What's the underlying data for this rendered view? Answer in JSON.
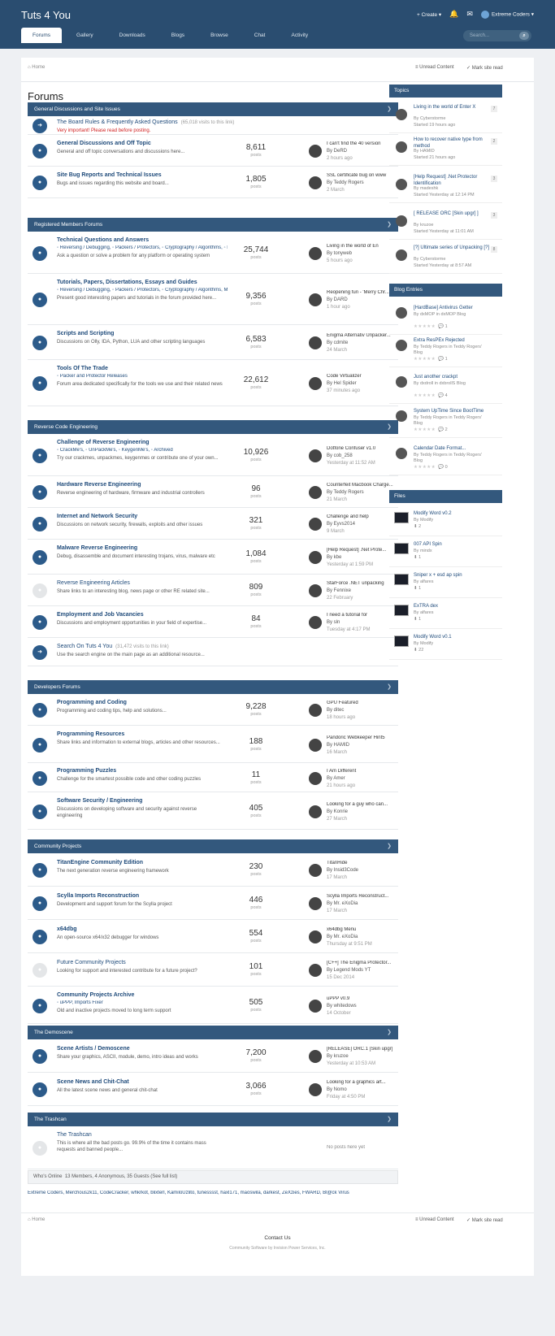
{
  "site": {
    "title": "Tuts 4 You",
    "create": "Create",
    "user": "Extreme Coders"
  },
  "nav": [
    "Forums",
    "Gallery",
    "Downloads",
    "Blogs",
    "Browse",
    "Chat",
    "Activity"
  ],
  "search": {
    "placeholder": "Search..."
  },
  "breadcrumb": "Home",
  "actions": {
    "unread": "Unread Content",
    "mark": "Mark site read"
  },
  "page_title": "Forums",
  "sections": [
    {
      "title": "General Discussions and Site Issues",
      "rows": [
        {
          "type": "redirect",
          "title": "The Board Rules & Frequently Asked Questions",
          "extra": "(65,018 visits to this link)",
          "desc": "Very important! Please read before posting."
        },
        {
          "title": "General Discussions and Off Topic",
          "desc": "General and off topic conversations and discussions here...",
          "count": "8,611",
          "last": "I can't find the 40 version",
          "by": "By DeRD",
          "when": "2 hours ago"
        },
        {
          "title": "Site Bug Reports and Technical Issues",
          "desc": "Bugs and issues regarding this website and board...",
          "count": "1,805",
          "last": "SSL certificate bug on www",
          "by": "By Teddy Rogers",
          "when": "2 March"
        }
      ]
    },
    {
      "title": "Registered Members Forums",
      "rows": [
        {
          "title": "Technical Questions and Answers",
          "subs": "◦ Reversing / Debugging,  ◦ Packers / Protectors,  ◦ Cryptography / Algorithms,  ◦ Miscellaneous Questions",
          "desc": "Ask a question or solve a problem for any platform or operating system",
          "count": "25,744",
          "last": "Living in the world of En",
          "by": "By tonyweb",
          "when": "5 hours ago"
        },
        {
          "title": "Tutorials, Papers, Dissertations, Essays and Guides",
          "subs": "◦ Reversing / Debugging,  ◦ Packers / Protectors,  ◦ Cryptography / Algorithms,  Miscellaneous Papers",
          "desc": "Present good interesting papers and tutorials in the forum provided here...",
          "count": "9,356",
          "last": "Reopening fun - 'Merry Chr...",
          "by": "By DARD",
          "when": "1 hour ago"
        },
        {
          "title": "Scripts and Scripting",
          "desc": "Discussions on Olly, IDA, Python, LUA and other scripting languages",
          "count": "6,583",
          "last": "Enigma Alternativ Unpacker...",
          "by": "By cdmite",
          "when": "24 March"
        },
        {
          "title": "Tools Of The Trade",
          "subs": "◦ Packer and Protector Releases",
          "desc": "Forum area dedicated specifically for the tools we use and their related news",
          "count": "22,612",
          "last": "Code Virtualizer",
          "by": "By Hel Spider",
          "when": "37 minutes ago"
        }
      ]
    },
    {
      "title": "Reverse Code Engineering",
      "rows": [
        {
          "title": "Challenge of Reverse Engineering",
          "subs": "◦ CrackMe's,  ◦ UnPackMe's,  ◦ KeygenMe's,  ◦ Archived",
          "desc": "Try our crackmes, unpackmes, keygenmes or contribute one of your own...",
          "count": "10,926",
          "last": "Dotfone Confuser v1.0",
          "by": "By cob_258",
          "when": "Yesterday at 11:52 AM"
        },
        {
          "title": "Hardware Reverse Engineering",
          "desc": "Reverse engineering of hardware, firmware and industrial controllers",
          "count": "96",
          "last": "Counterfeit Macbook Charge...",
          "by": "By Teddy Rogers",
          "when": "21 March"
        },
        {
          "title": "Internet and Network Security",
          "desc": "Discussions on network security, firewalls, exploits and other issues",
          "count": "321",
          "last": "Challenge and help",
          "by": "By Eyvs2014",
          "when": "9 March"
        },
        {
          "title": "Malware Reverse Engineering",
          "desc": "Debug, disassemble and document interesting trojans, virus, malware etc",
          "count": "1,084",
          "last": "[Help Request] .Net Prote...",
          "by": "By kbe",
          "when": "Yesterday at 1:59 PM"
        },
        {
          "type": "grey",
          "title": "Reverse Engineering Articles",
          "desc": "Share links to an interesting blog, news page or other RE related site...",
          "count": "809",
          "last": "StarForce .NET unpacking",
          "by": "By Fennixe",
          "when": "22 February"
        },
        {
          "title": "Employment and Job Vacancies",
          "desc": "Discussions and employment opportunities in your field of expertise...",
          "count": "84",
          "last": "I need a tutorial for",
          "by": "By sln",
          "when": "Tuesday at 4:17 PM"
        },
        {
          "type": "redirect",
          "title": "Search On Tuts 4 You",
          "extra": "(31,472 visits to this link)",
          "desc": "Use the search engine on the main page as an additional resource..."
        }
      ]
    },
    {
      "title": "Developers Forums",
      "rows": [
        {
          "title": "Programming and Coding",
          "desc": "Programming and coding tips, help and solutions...",
          "count": "9,228",
          "last": "GPU Featured",
          "by": "By ditec",
          "when": "18 hours ago"
        },
        {
          "title": "Programming Resources",
          "desc": "Share links and information to external blogs, articles and other resources...",
          "count": "188",
          "last": "Pandoric Webkeeper Hint5",
          "by": "By HAMID",
          "when": "16 March"
        },
        {
          "title": "Programming Puzzles",
          "desc": "Challenge for the smartest possible code and other coding puzzles",
          "count": "11",
          "last": "I Am Different",
          "by": "By Amer",
          "when": "21 hours ago"
        },
        {
          "title": "Software Security / Engineering",
          "desc": "Discussions on developing software and security against reverse engineering",
          "count": "405",
          "last": "Looking for a guy who can...",
          "by": "By Konrie",
          "when": "27 March"
        }
      ]
    },
    {
      "title": "Community Projects",
      "rows": [
        {
          "title": "TitanEngine Community Edition",
          "desc": "The next generation reverse engineering framework",
          "count": "230",
          "last": "TitanHide",
          "by": "By Insid3Code",
          "when": "17 March"
        },
        {
          "title": "Scylla Imports Reconstruction",
          "desc": "Development and support forum for the Scylla project",
          "count": "446",
          "last": "Scylla Imports Reconstruct...",
          "by": "By Mr. eXoDia",
          "when": "17 March"
        },
        {
          "title": "x64dbg",
          "desc": "An open-source x64/x32 debugger for windows",
          "count": "554",
          "last": "x64dbg Menu",
          "by": "By Mr. eXoDia",
          "when": "Thursday at 9:51 PM"
        },
        {
          "type": "grey",
          "title": "Future Community Projects",
          "desc": "Looking for support and interested contribute for a future project?",
          "count": "101",
          "last": "[C++] The Enigma Protector...",
          "by": "By Legend Mods YT",
          "when": "15 Dec 2014"
        },
        {
          "title": "Community Projects Archive",
          "subs": "◦ uPPP,  Imports Fixer",
          "desc": "Old and inactive projects moved to long term support",
          "count": "505",
          "last": "uPPP v0.9",
          "by": "By whitedows",
          "when": "14 October"
        }
      ]
    },
    {
      "title": "The Demoscene",
      "rows": [
        {
          "title": "Scene Artists / Demoscene",
          "desc": "Share your graphics, ASCII, module, demo, intro ideas and works",
          "count": "7,200",
          "last": "[RELEASE] ORC.1 [Skin upgr]",
          "by": "By kruzoe",
          "when": "Yesterday at 10:53 AM"
        },
        {
          "title": "Scene News and Chit-Chat",
          "desc": "All the latest scene news and general chit-chat",
          "count": "3,066",
          "last": "Looking for a graphics art...",
          "by": "By Nomo",
          "when": "Friday at 4:50 PM"
        }
      ]
    },
    {
      "title": "The Trashcan",
      "rows": [
        {
          "type": "trash",
          "title": "The Trashcan",
          "desc": "This is where all the bad posts go. 99.9% of the time it contains mass requests and banned people...",
          "last": "No posts here yet"
        }
      ]
    }
  ],
  "online": {
    "label": "Who's Online",
    "text": "13 Members, 4 Anonymous, 35 Guests (See full list)"
  },
  "online_users": "Extreme Coders, Merchous2k11, CodeCracker, whkrkot, blixterl, KamiloUzlito, tunesssst, haxl171, maoswila, darkest, ZeXzies, FWARD, Bl@ck Virus",
  "sidebar": {
    "topics_title": "Topics",
    "topics": [
      {
        "title": "Living in the world of Enter X",
        "meta": "By Cyberstorme",
        "when": "Started 19 hours ago",
        "c": "7"
      },
      {
        "title": "How to recover native type from method",
        "meta": "By HAMID",
        "when": "Started 21 hours ago",
        "c": "2"
      },
      {
        "title": "[Help Request] .Net Protector Identification",
        "meta": "By madeshk",
        "when": "Started Yesterday at 12:14 PM",
        "c": "3"
      },
      {
        "title": "[ RELEASE ORC [Skin upgr] ]",
        "meta": "By kruzoe",
        "when": "Started Yesterday at 11:01 AM",
        "c": "3"
      },
      {
        "title": "[?] Ultimate series of Unpacking [?]",
        "meta": "By Cyberstorme",
        "when": "Started Yesterday at 8:57 AM",
        "c": "8"
      }
    ],
    "blogs_title": "Blog Entries",
    "blogs": [
      {
        "title": "[HardBase] Antivirus Getter",
        "meta": "By dxMOP in dxMOP Blog",
        "c": "1"
      },
      {
        "title": "Extra ResPEx Rejected",
        "meta": "By Teddy Rogers in Teddy Rogers' Blog",
        "c": "1"
      },
      {
        "title": "Just another crackpt",
        "meta": "By dxdroll in dxbrollS Blog",
        "c": "4"
      },
      {
        "title": "System UpTime Since BootTime",
        "meta": "By Teddy Rogers in Teddy Rogers' Blog",
        "c": "2"
      },
      {
        "title": "Calendar Date Format...",
        "meta": "By Teddy Rogers in Teddy Rogers' Blog",
        "c": "0"
      }
    ],
    "files_title": "Files",
    "files": [
      {
        "title": "Modify Word v0.2",
        "meta": "By Modify",
        "c": "2"
      },
      {
        "title": "007 API Spin",
        "meta": "By mindx",
        "c": "1"
      },
      {
        "title": "Sniper x + esd ap spin",
        "meta": "By alfares",
        "c": "1"
      },
      {
        "title": "ExTRA dex",
        "meta": "By alfares",
        "c": "1"
      },
      {
        "title": "Modify Word v0.1",
        "meta": "By Modify",
        "c": "22"
      }
    ]
  },
  "posts_label": "posts",
  "footer": {
    "contact": "Contact Us",
    "powered": "Community Software by Invision Power Services, Inc."
  }
}
